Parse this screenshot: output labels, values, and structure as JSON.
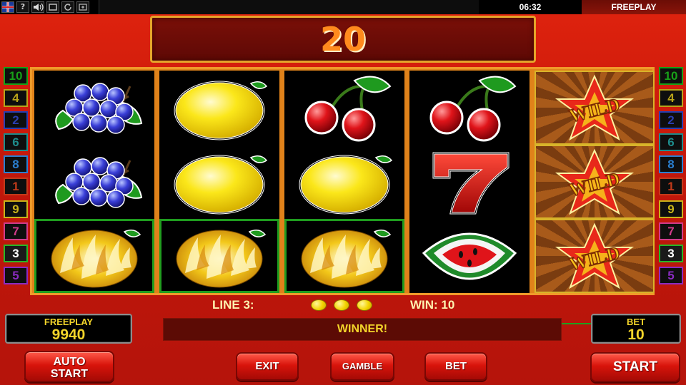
{
  "topbar": {
    "icons": [
      "uk-flag-icon",
      "help-icon",
      "speaker-icon",
      "fullscreen-icon",
      "refresh-icon",
      "resize-icon"
    ],
    "help_glyph": "?",
    "time": "06:32",
    "mode": "FREEPLAY"
  },
  "win_display": {
    "value": "20"
  },
  "line_indicators": {
    "left": [
      "10",
      "4",
      "2",
      "6",
      "8",
      "1",
      "9",
      "7",
      "3",
      "5"
    ],
    "right": [
      "10",
      "4",
      "2",
      "6",
      "8",
      "1",
      "9",
      "7",
      "3",
      "5"
    ],
    "colors": [
      "#18a018",
      "#b8a31a",
      "#2a3fb0",
      "#1e8c8c",
      "#2a7fd0",
      "#c23a1a",
      "#c8b21a",
      "#d03b8a",
      "#26b826",
      "#8a2bc0"
    ],
    "highlighted": "3"
  },
  "reels": [
    [
      "grapes",
      "grapes",
      "lemon-burning"
    ],
    [
      "lemon",
      "lemon",
      "lemon-burning"
    ],
    [
      "cherries",
      "lemon",
      "lemon-burning"
    ],
    [
      "cherries",
      "seven",
      "watermelon"
    ],
    [
      "wild",
      "wild",
      "wild"
    ]
  ],
  "wild_text": "WILD",
  "win_info": {
    "line_label": "LINE 3:",
    "win_label": "WIN: 10",
    "symbol_count": 3
  },
  "credit_panel": {
    "label": "FREEPLAY",
    "value": "9940"
  },
  "bet_panel": {
    "label": "BET",
    "value": "10"
  },
  "message": "WINNER!",
  "buttons": {
    "auto_start_line1": "AUTO",
    "auto_start_line2": "START",
    "exit": "EXIT",
    "gamble": "GAMBLE",
    "bet": "BET",
    "start": "START"
  },
  "colors": {
    "background": "#d01c0c",
    "reel_frame": "#e0821a",
    "highlight": "#1f9c1f",
    "panel_text": "#f2d42a",
    "win_digits": "#ff8a1d"
  }
}
